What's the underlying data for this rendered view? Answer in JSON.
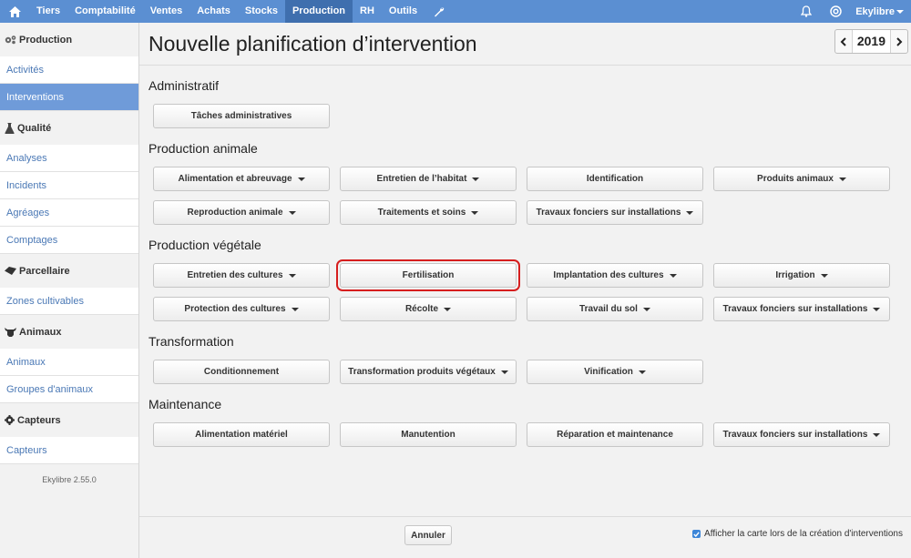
{
  "topbar": {
    "items": [
      "Tiers",
      "Comptabilité",
      "Ventes",
      "Achats",
      "Stocks",
      "Production",
      "RH",
      "Outils"
    ],
    "active": "Production",
    "user": "Ekylibre"
  },
  "sidebar": {
    "sections": [
      {
        "title": "Production",
        "icon": "cogs-icon",
        "items": [
          "Activités",
          "Interventions"
        ],
        "active": "Interventions"
      },
      {
        "title": "Qualité",
        "icon": "flask-icon",
        "items": [
          "Analyses",
          "Incidents",
          "Agréages",
          "Comptages"
        ]
      },
      {
        "title": "Parcellaire",
        "icon": "map-icon",
        "items": [
          "Zones cultivables"
        ]
      },
      {
        "title": "Animaux",
        "icon": "cow-icon",
        "items": [
          "Animaux",
          "Groupes d'animaux"
        ]
      },
      {
        "title": "Capteurs",
        "icon": "gear-icon",
        "items": [
          "Capteurs"
        ]
      }
    ],
    "version": "Ekylibre 2.55.0"
  },
  "header": {
    "title": "Nouvelle planification d’intervention",
    "year": "2019"
  },
  "groups": [
    {
      "title": "Administratif",
      "buttons": [
        {
          "label": "Tâches administratives",
          "dropdown": false
        }
      ]
    },
    {
      "title": "Production animale",
      "buttons": [
        {
          "label": "Alimentation et abreuvage",
          "dropdown": true
        },
        {
          "label": "Entretien de l’habitat",
          "dropdown": true
        },
        {
          "label": "Identification",
          "dropdown": false
        },
        {
          "label": "Produits animaux",
          "dropdown": true
        },
        {
          "label": "Reproduction animale",
          "dropdown": true
        },
        {
          "label": "Traitements et soins",
          "dropdown": true
        },
        {
          "label": "Travaux fonciers sur installations",
          "dropdown": true
        }
      ]
    },
    {
      "title": "Production végétale",
      "buttons": [
        {
          "label": "Entretien des cultures",
          "dropdown": true
        },
        {
          "label": "Fertilisation",
          "dropdown": false,
          "highlight": true
        },
        {
          "label": "Implantation des cultures",
          "dropdown": true
        },
        {
          "label": "Irrigation",
          "dropdown": true
        },
        {
          "label": "Protection des cultures",
          "dropdown": true
        },
        {
          "label": "Récolte",
          "dropdown": true
        },
        {
          "label": "Travail du sol",
          "dropdown": true
        },
        {
          "label": "Travaux fonciers sur installations",
          "dropdown": true
        }
      ]
    },
    {
      "title": "Transformation",
      "buttons": [
        {
          "label": "Conditionnement",
          "dropdown": false
        },
        {
          "label": "Transformation produits végétaux",
          "dropdown": true
        },
        {
          "label": "Vinification",
          "dropdown": true
        }
      ]
    },
    {
      "title": "Maintenance",
      "buttons": [
        {
          "label": "Alimentation matériel",
          "dropdown": false
        },
        {
          "label": "Manutention",
          "dropdown": false
        },
        {
          "label": "Réparation et maintenance",
          "dropdown": false
        },
        {
          "label": "Travaux fonciers sur installations",
          "dropdown": true
        }
      ]
    }
  ],
  "footer": {
    "cancel_label": "Annuler",
    "map_checkbox_label": "Afficher la carte lors de la création d'interventions",
    "map_checkbox_checked": true
  },
  "colors": {
    "topbar": "#5b8fd2",
    "topbar_active": "#3f6fae",
    "sidebar_active": "#6f9bd9",
    "link": "#4a78b5",
    "highlight_outline": "#d61e1e"
  }
}
